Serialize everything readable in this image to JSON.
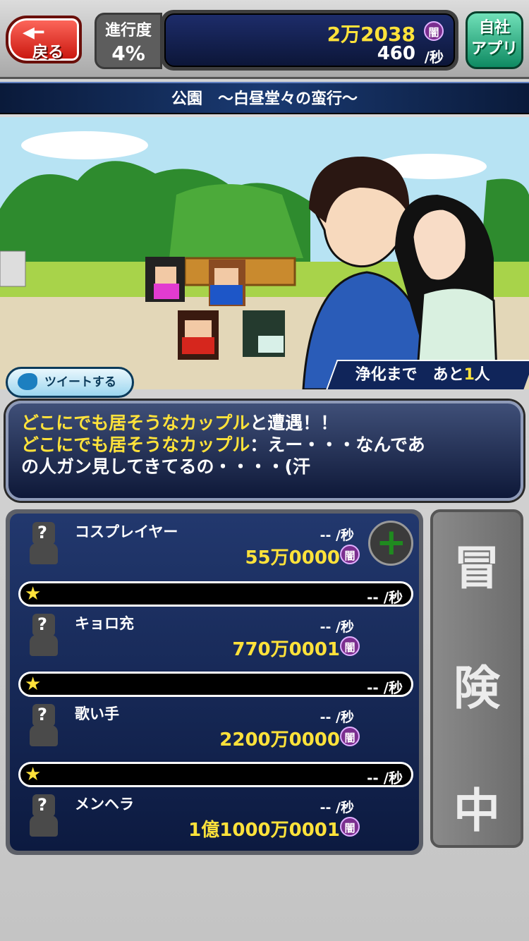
{
  "header": {
    "back_label": "戻る",
    "progress_label": "進行度",
    "progress_value": "4%",
    "darkness_total": "2万2038",
    "darkness_unit": "闇",
    "darkness_rate": "460",
    "rate_unit": "/秒",
    "app_label_1": "自社",
    "app_label_2": "アプリ"
  },
  "stage": {
    "title": "公園　～白昼堂々の蛮行～"
  },
  "scene": {
    "tweet_label": "ツイートする",
    "remaining_prefix": "浄化まで　あと",
    "remaining_count": "1",
    "remaining_suffix": "人"
  },
  "message": {
    "line1_highlight": "どこにでも居そうなカップル",
    "line1_rest": "と遭遇！！",
    "line2_highlight": "どこにでも居そうなカップル",
    "line2_rest": "：えー・・・なんであ",
    "line3": "の人ガン見してきてるの・・・・(汗"
  },
  "units": [
    {
      "name": "コスプレイヤー",
      "rate": "-- /秒",
      "cost": "55万0000",
      "bonus": "-- /秒"
    },
    {
      "name": "キョロ充",
      "rate": "-- /秒",
      "cost": "770万0001",
      "bonus": "-- /秒"
    },
    {
      "name": "歌い手",
      "rate": "-- /秒",
      "cost": "2200万0000",
      "bonus": "-- /秒"
    },
    {
      "name": "メンヘラ",
      "rate": "-- /秒",
      "cost": "1億1000万0001"
    }
  ],
  "side_button": {
    "c1": "冒",
    "c2": "険",
    "c3": "中"
  },
  "colors": {
    "accent_yellow": "#ffe23a",
    "panel_navy": "#0c1a40",
    "darkness_purple": "#7b2f8f"
  }
}
